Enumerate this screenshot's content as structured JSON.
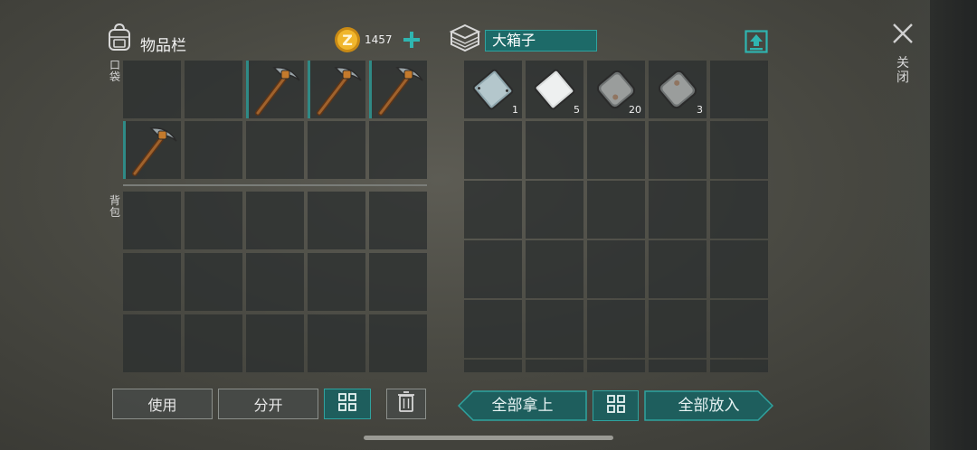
{
  "inventory": {
    "title": "物品栏",
    "currency": "1457",
    "pocket_label": "口袋",
    "backpack_label": "背包",
    "pocket_slots": [
      "pickaxe",
      "pickaxe",
      "pickaxe",
      "pickaxe"
    ]
  },
  "chest": {
    "name": "大箱子",
    "slots": [
      {
        "item": "steel-plate",
        "qty": "1"
      },
      {
        "item": "aluminum-plate",
        "qty": "5"
      },
      {
        "item": "iron-plate",
        "qty": "20"
      },
      {
        "item": "iron-plate",
        "qty": "3"
      }
    ]
  },
  "buttons": {
    "use": "使用",
    "split": "分开",
    "take_all": "全部拿上",
    "put_all": "全部放入"
  },
  "close": {
    "label": "关闭"
  },
  "colors": {
    "accent": "#2fa39f",
    "accent_dark": "#1e5e5d",
    "coin": "#e2a21e"
  }
}
